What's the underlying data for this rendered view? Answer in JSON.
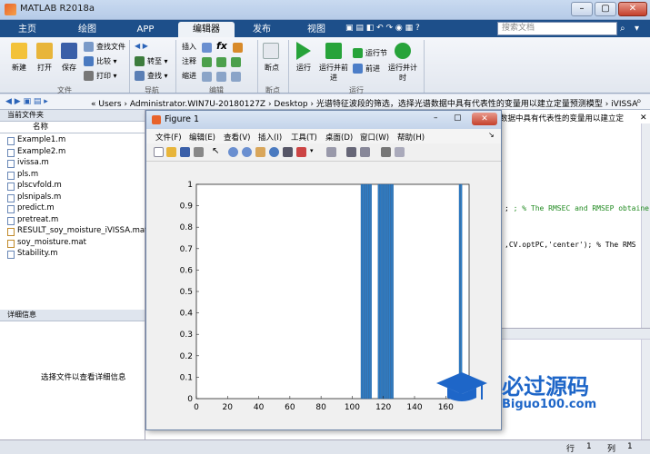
{
  "window": {
    "title": "MATLAB R2018a"
  },
  "tabs": [
    {
      "label": "主页",
      "active": false
    },
    {
      "label": "绘图",
      "active": false
    },
    {
      "label": "APP",
      "active": false
    },
    {
      "label": "编辑器",
      "active": true
    },
    {
      "label": "发布",
      "active": false
    },
    {
      "label": "视图",
      "active": false
    }
  ],
  "search": {
    "placeholder": "搜索文档"
  },
  "ribbon": {
    "file": {
      "group": "文件",
      "new": "新建",
      "open": "打开",
      "save": "保存",
      "find_files": "查找文件",
      "compare": "比较",
      "print": "打印"
    },
    "nav": {
      "group": "导航",
      "goto": "转至",
      "find": "查找"
    },
    "edit": {
      "group": "编辑",
      "insert": "插入",
      "comment": "注释",
      "indent": "缩进"
    },
    "breakpoint": {
      "group": "断点",
      "label": "断点"
    },
    "run": {
      "group": "运行",
      "run": "运行",
      "run_advance": "运行并前进",
      "run_section": "运行节",
      "advance": "前进",
      "run_time": "运行并计时"
    }
  },
  "address": {
    "path": "« Users › Administrator.WIN7U-20180127Z › Desktop › 光谱特征波段的筛选，选择光谱数据中具有代表性的变量用以建立定量预测模型 › iVISSA"
  },
  "file_panel": {
    "title": "当前文件夹",
    "col_name": "名称",
    "files": [
      "Example1.m",
      "Example2.m",
      "ivissa.m",
      "pls.m",
      "plscvfold.m",
      "plsnipals.m",
      "predict.m",
      "pretreat.m",
      "RESULT_soy_moisture_iVISSA.mat",
      "soy_moisture.mat",
      "Stability.m"
    ]
  },
  "detail_panel": {
    "title": "详细信息",
    "message": "选择文件以查看详细信息"
  },
  "editor": {
    "header": "数据中具有代表性的变量用以建立定",
    "line1": "; % The RMSEC and RMSEP obtaine",
    "line2": ",CV.optPC,'center');  % The RMS"
  },
  "status": {
    "row_label": "行",
    "row_value": "1",
    "col_label": "列",
    "col_value": "1"
  },
  "figure": {
    "title": "Figure 1",
    "menu": [
      "文件(F)",
      "编辑(E)",
      "查看(V)",
      "插入(I)",
      "工具(T)",
      "桌面(D)",
      "窗口(W)",
      "帮助(H)"
    ]
  },
  "watermark": {
    "brand": "必过源码",
    "url": "Biguo100.com"
  },
  "colors": {
    "accent": "#1d4f8a",
    "bar": "#2f7fc8",
    "run_green": "#27a33a"
  },
  "chart_data": {
    "type": "bar",
    "xlim": [
      0,
      175
    ],
    "ylim": [
      0,
      1
    ],
    "xticks": [
      0,
      20,
      40,
      60,
      80,
      100,
      120,
      140,
      160
    ],
    "yticks": [
      0,
      0.1,
      0.2,
      0.3,
      0.4,
      0.5,
      0.6,
      0.7,
      0.8,
      0.9,
      1
    ],
    "x": [
      106,
      107,
      108,
      109,
      110,
      111,
      112,
      117,
      118,
      119,
      120,
      121,
      122,
      123,
      124,
      125,
      126,
      169,
      170
    ],
    "values": [
      1,
      1,
      1,
      1,
      1,
      1,
      1,
      1,
      1,
      1,
      1,
      1,
      1,
      1,
      1,
      1,
      1,
      1,
      1
    ],
    "grid": false
  }
}
